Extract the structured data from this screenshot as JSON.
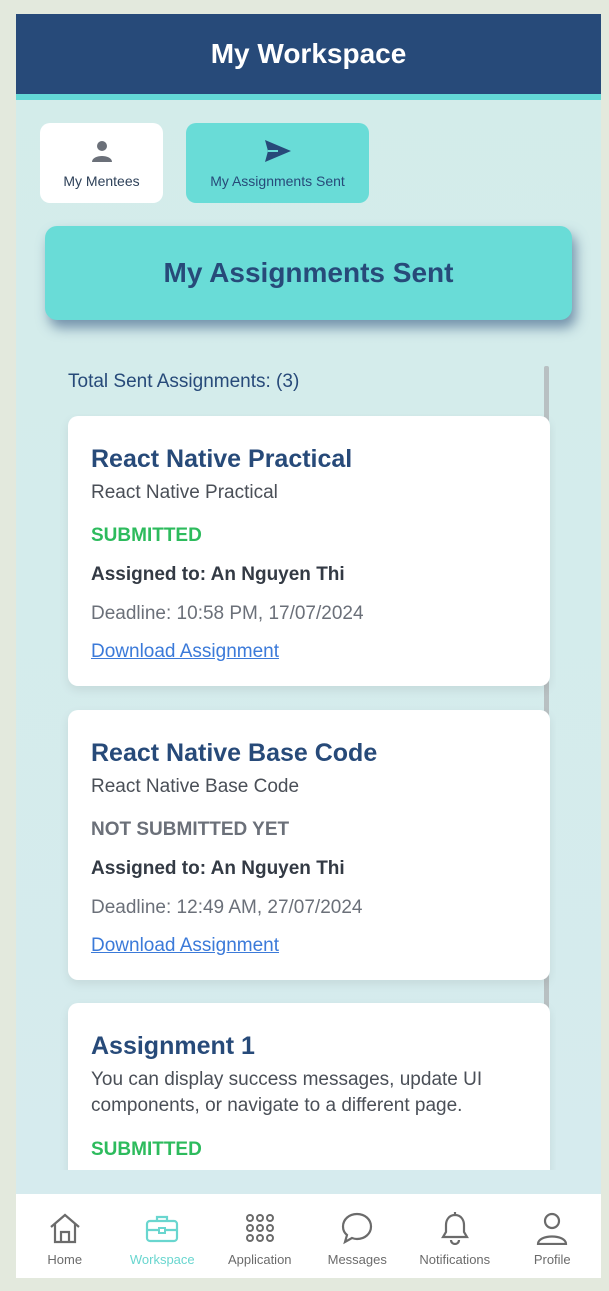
{
  "header": {
    "title": "My Workspace"
  },
  "tabs": [
    {
      "label": "My Mentees",
      "icon": "person-icon"
    },
    {
      "label": "My Assignments Sent",
      "icon": "send-icon"
    }
  ],
  "banner": {
    "title": "My Assignments Sent"
  },
  "summary": {
    "total_label": "Total Sent Assignments: (3)"
  },
  "assignments": [
    {
      "title": "React Native Practical",
      "description": "React Native Practical",
      "status": "SUBMITTED",
      "assigned_to": "Assigned to: An Nguyen Thi",
      "deadline": "Deadline: 10:58 PM, 17/07/2024",
      "link": "Download Assignment"
    },
    {
      "title": "React Native Base Code",
      "description": "React Native Base Code",
      "status": "NOT SUBMITTED YET",
      "assigned_to": "Assigned to: An Nguyen Thi",
      "deadline": "Deadline: 12:49 AM, 27/07/2024",
      "link": "Download Assignment"
    },
    {
      "title": "Assignment 1",
      "description": "You can display success messages, update UI components, or navigate to a different page.",
      "status": "SUBMITTED"
    }
  ],
  "nav": [
    {
      "label": "Home",
      "icon": "home-icon"
    },
    {
      "label": "Workspace",
      "icon": "briefcase-icon",
      "active": true
    },
    {
      "label": "Application",
      "icon": "grid-icon"
    },
    {
      "label": "Messages",
      "icon": "chat-icon"
    },
    {
      "label": "Notifications",
      "icon": "bell-icon"
    },
    {
      "label": "Profile",
      "icon": "profile-icon"
    }
  ],
  "colors": {
    "header_bg": "#274a79",
    "accent": "#69dcd7",
    "submitted": "#2dbb5d",
    "not_submitted": "#6b7079",
    "link": "#3b7ad9"
  }
}
